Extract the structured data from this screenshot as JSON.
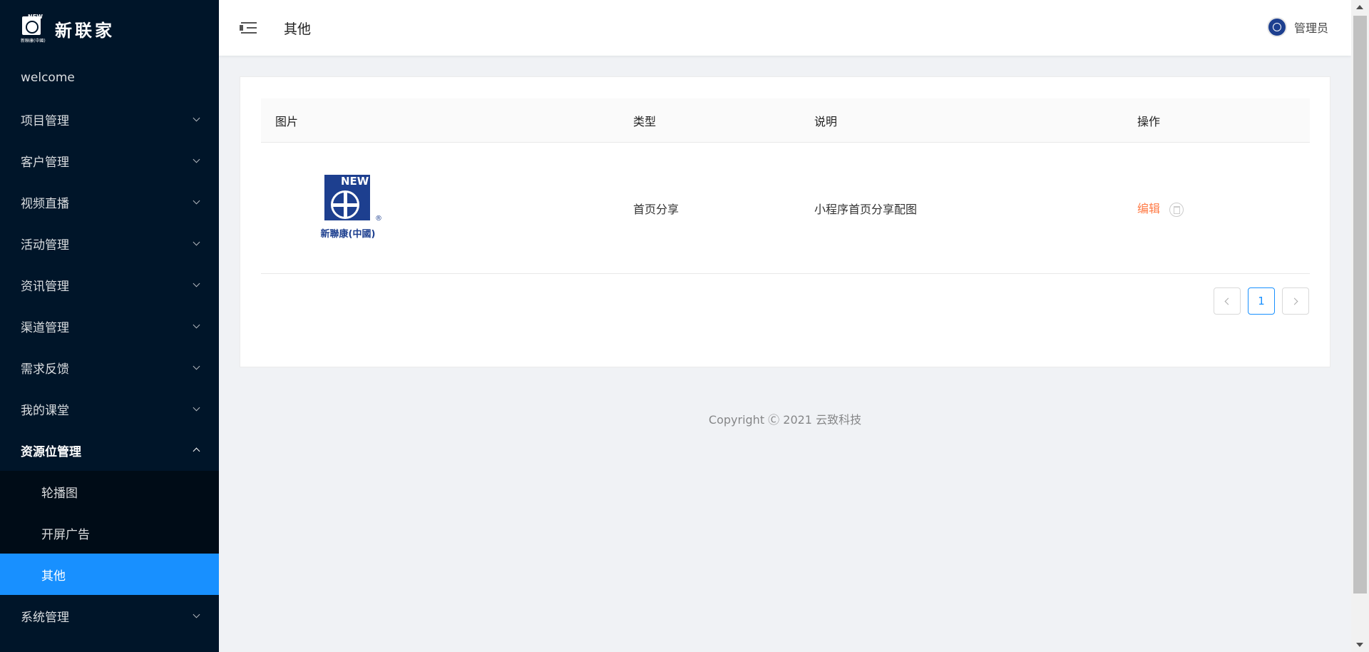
{
  "app": {
    "logo_text": "新联家",
    "logo_mark_text": "NEW",
    "logo_mark_sub": "新聯康(中國)"
  },
  "sidebar": {
    "items": [
      {
        "label": "welcome"
      },
      {
        "label": "项目管理"
      },
      {
        "label": "客户管理"
      },
      {
        "label": "视频直播"
      },
      {
        "label": "活动管理"
      },
      {
        "label": "资讯管理"
      },
      {
        "label": "渠道管理"
      },
      {
        "label": "需求反馈"
      },
      {
        "label": "我的课堂"
      },
      {
        "label": "资源位管理",
        "open": true
      },
      {
        "label": "系统管理"
      }
    ],
    "submenu": [
      {
        "label": "轮播图"
      },
      {
        "label": "开屏广告"
      },
      {
        "label": "其他",
        "active": true
      }
    ]
  },
  "header": {
    "title": "其他",
    "user_name": "管理员"
  },
  "table": {
    "columns": [
      "图片",
      "类型",
      "说明",
      "操作"
    ],
    "rows": [
      {
        "image_caption": "新聯康(中國)",
        "image_badge": "NEW",
        "type": "首页分享",
        "description": "小程序首页分享配图",
        "action_edit": "编辑"
      }
    ]
  },
  "pagination": {
    "current_page": "1"
  },
  "footer": {
    "copyright": "Copyright Ⓒ 2021 云致科技"
  },
  "colors": {
    "sidebar_bg": "#001529",
    "active": "#1890ff",
    "edit_link": "#ff7a45"
  }
}
